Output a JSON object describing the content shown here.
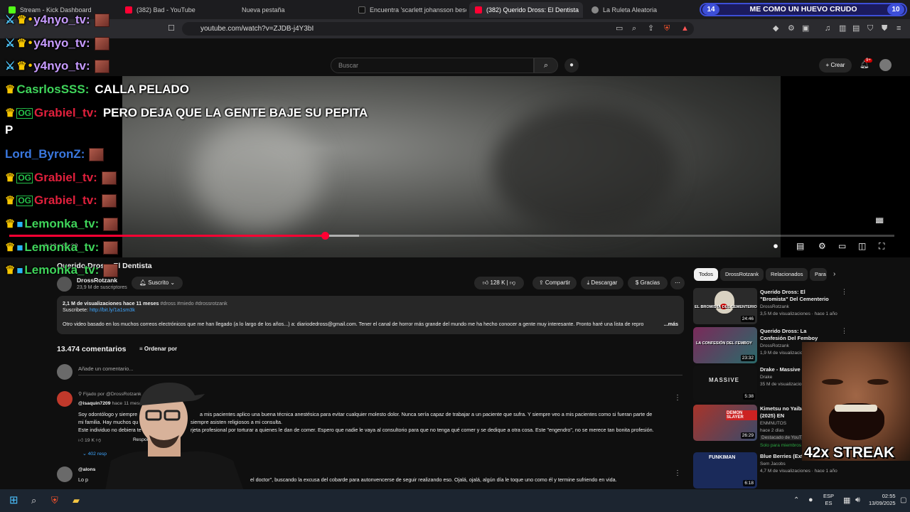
{
  "browser": {
    "tabs": [
      {
        "label": "Stream - Kick Dashboard",
        "favicon_color": "#53fc18"
      },
      {
        "label": "(382) Bad - YouTube",
        "favicon_color": "#ff0033"
      },
      {
        "label": "Nueva pestaña",
        "favicon_color": "#555555"
      },
      {
        "label": "Encuentra 'scarlett johansson beso c",
        "favicon_color": "#111111"
      },
      {
        "label": "(382) Querido Dross: El Dentista",
        "favicon_color": "#ff0033"
      },
      {
        "label": "La Ruleta Aleatoria",
        "favicon_color": "#888888"
      }
    ],
    "url": "youtube.com/watch?v=ZJDB-j4Y3bI"
  },
  "overlay": {
    "goal": {
      "left_value": "14",
      "text": "ME COMO UN HUEVO CRUDO",
      "right_value": "10"
    },
    "streak": "42x STREAK"
  },
  "chat": [
    {
      "user": "y4nyo_tv:",
      "color": "#c79bff",
      "badges": [
        "sword",
        "crown",
        "dot"
      ],
      "message": ""
    },
    {
      "user": "y4nyo_tv:",
      "color": "#c79bff",
      "badges": [
        "sword",
        "crown",
        "dot"
      ],
      "message": ""
    },
    {
      "user": "y4nyo_tv:",
      "color": "#c79bff",
      "badges": [
        "sword",
        "crown",
        "dot"
      ],
      "message": ""
    },
    {
      "user": "CasrlosSSS:",
      "color": "#3fd45a",
      "badges": [
        "crown"
      ],
      "message": "CALLA PELADO"
    },
    {
      "user": "Grabiel_tv:",
      "color": "#e0203c",
      "badges": [
        "crown",
        "og"
      ],
      "message": "PERO DEJA QUE LA GENTE BAJE SU PEPITA"
    },
    {
      "user": "",
      "color": "#ffffff",
      "badges": [],
      "message": "P"
    },
    {
      "user": "Lord_ByronZ:",
      "color": "#3a78e0",
      "badges": [],
      "message": ""
    },
    {
      "user": "Grabiel_tv:",
      "color": "#e0203c",
      "badges": [
        "crown",
        "og"
      ],
      "message": ""
    },
    {
      "user": "Grabiel_tv:",
      "color": "#e0203c",
      "badges": [
        "crown",
        "og"
      ],
      "message": ""
    },
    {
      "user": "Lemonka_tv:",
      "color": "#3fd45a",
      "badges": [
        "crown",
        "cube"
      ],
      "message": ""
    },
    {
      "user": "Lemonka_tv:",
      "color": "#3fd45a",
      "badges": [
        "crown",
        "cube"
      ],
      "message": ""
    },
    {
      "user": "Lemonka_tv:",
      "color": "#3fd45a",
      "badges": [
        "crown",
        "cube"
      ],
      "message": ""
    }
  ],
  "youtube": {
    "search_placeholder": "Buscar",
    "create_label": "Crear",
    "notif_count": "9+",
    "player": {
      "timecode": "8:13 / 21:20",
      "progress": 0.357,
      "buffered": 0.395
    },
    "video": {
      "title": "Querido Dross: El Dentista",
      "channel": "DrossRotzank",
      "subscribers": "23,9 M de suscriptores",
      "subscribe_label": "Suscrito",
      "likes": "128 K",
      "share_label": "Compartir",
      "download_label": "Descargar",
      "thanks_label": "Gracias"
    },
    "description": {
      "stats": "2,1 M de visualizaciones  hace 11 meses",
      "tags": "#dross #miedo #drossrotzank",
      "subscribe_prefix": "Suscribete: ",
      "subscribe_link": "http://bit.ly/1a1sm3k",
      "body": "Otro video basado en los muchos correos electrónicos que me han llegado (a lo largo de los años...) a: diariodedross@gmail.com. Tener el canal de horror más grande del mundo me ha hecho conocer a gente muy interesante. Pronto haré una lista de repro",
      "more": "...más"
    },
    "comments": {
      "count": "13.474 comentarios",
      "sort_label": "Ordenar por",
      "add_placeholder": "Añade un comentario...",
      "pinned_label": "Fijado por @DrossRotzank",
      "first": {
        "author": "@isaquin7209",
        "time": "hace 11 meses",
        "lines": [
          "Soy odontólogo y siempre",
          "a mis pacientes aplico una buena técnica anestésica para evitar cualquier molesto dolor. Nunca sería capaz de trabajar a un paciente que sufra. Y siempre veo a mis pacientes como si fueran parte de",
          "mi familia. Hay muchos qu",
          "siempre asisten religiosos a mi consulta.",
          "Este individuo no debiera te",
          "rjeta profesional por torturar a quienes le dan de comer. Espero que nadie le vaya al consultorio para que no tenga qué comer y se dedique a otra cosa. Este \"engendro\", no se merece tan bonita profesión."
        ],
        "likes": "19 K",
        "reply_label": "Respon",
        "replies": "402 resp"
      },
      "second": {
        "author": "@alons",
        "line_a": "Lo p",
        "line_b": "el doctor\", buscando la excusa del cobarde para autonvencerse de seguir realizando eso. Ojalá, ojalá, algún día le toque uno como él y termine sufriendo en vida."
      }
    },
    "chips": [
      "Todos",
      "DrossRotzank",
      "Relacionados",
      "Para"
    ],
    "related": [
      {
        "title": "Querido Dross: El \"Bromista\" Del Cementerio",
        "channel": "DrossRotzank",
        "meta": "3,5 M de visualizaciones · hace 1 año",
        "duration": "24:46",
        "thumb_label": "EL BROMISTA DEL CEMENTERIO",
        "thumb_color": "#2a2a2a"
      },
      {
        "title": "Querido Dross: La Confesión Del Femboy",
        "channel": "DrossRotzank",
        "meta": "1,9 M de visualizaciones",
        "duration": "23:32",
        "thumb_label": "LA CONFESIÓN DEL FEMBOY",
        "thumb_color": "#7a2a5a"
      },
      {
        "title": "Drake - Massive",
        "channel": "Drake",
        "meta": "35 M de visualizacion",
        "duration": "5:38",
        "thumb_label": "MASSIVE",
        "thumb_color": "#111111"
      },
      {
        "title": "Kimetsu no Yaiba infinito (2025) EN",
        "channel": "ENMNUTOS",
        "meta": "hace 2 días",
        "duration": "26:29",
        "thumb_label": "DEMON SLAYER",
        "thumb_color": "#a8342a",
        "extra1": "Destacado de YouT",
        "extra2": "Solo para miembros"
      },
      {
        "title": "Blue Berries (Exten",
        "channel": "Sem Jacobs",
        "meta": "4,7 M de visualizaciones · hace 1 año",
        "duration": "6:18",
        "thumb_label": "FUNKIMAN",
        "thumb_color": "#1a2a5a"
      }
    ]
  },
  "taskbar": {
    "lang_top": "ESP",
    "lang_bottom": "ES",
    "time": "02:55",
    "date": "13/09/2025"
  }
}
